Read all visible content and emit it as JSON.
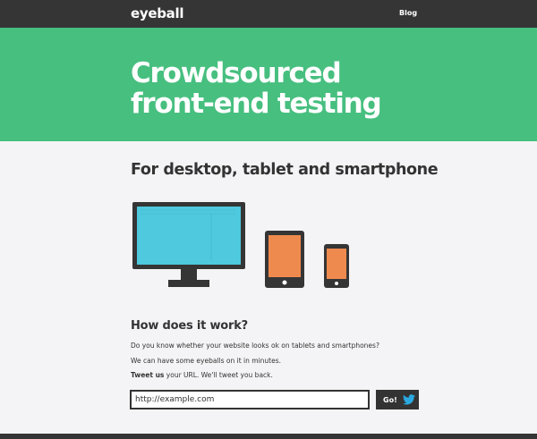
{
  "navbar": {
    "logo": "eyeball",
    "blog_link": "Blog"
  },
  "hero": {
    "title_line1": "Crowdsourced",
    "title_line2": "front-end testing"
  },
  "subtitle": "For desktop, tablet and smartphone",
  "devices": {
    "icons": [
      "desktop-monitor-icon",
      "tablet-icon",
      "smartphone-icon"
    ],
    "colors": {
      "screen_desktop": "#4ec9dd",
      "screen_mobile": "#ef8a4e",
      "device_frame": "#353535"
    }
  },
  "how": {
    "heading": "How does it work?",
    "line1": "Do you know whether your website looks ok on tablets and smartphones?",
    "line2": "We can have some eyeballs on it in minutes.",
    "line3_bold": "Tweet us",
    "line3_rest": " your URL. We'll tweet you back."
  },
  "form": {
    "url_placeholder": "http://example.com",
    "go_label": "Go!",
    "go_icon": "twitter-bird-icon"
  },
  "colors": {
    "brand_green": "#47bf7f",
    "nav_dark": "#353535",
    "twitter_blue": "#2aa9e0"
  }
}
